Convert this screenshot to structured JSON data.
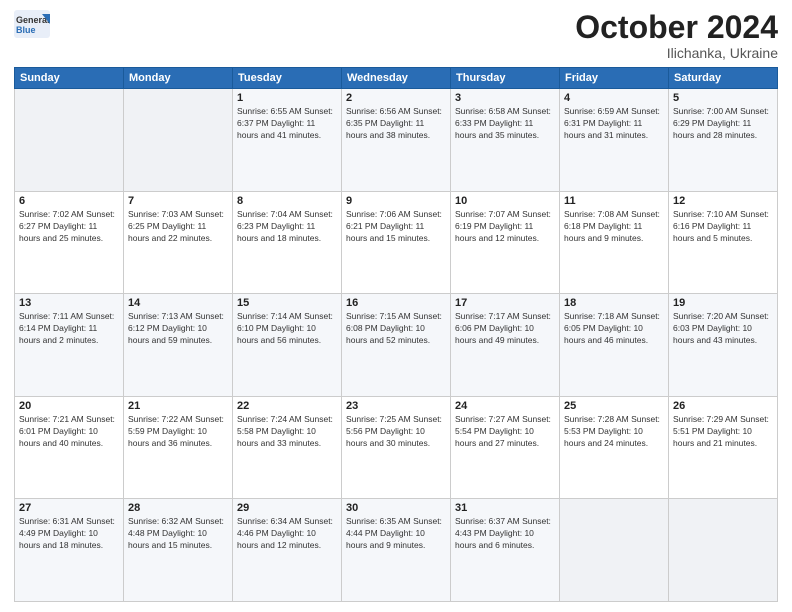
{
  "logo": {
    "general": "General",
    "blue": "Blue"
  },
  "header": {
    "month": "October 2024",
    "location": "Ilichanka, Ukraine"
  },
  "days_of_week": [
    "Sunday",
    "Monday",
    "Tuesday",
    "Wednesday",
    "Thursday",
    "Friday",
    "Saturday"
  ],
  "weeks": [
    [
      {
        "day": "",
        "info": ""
      },
      {
        "day": "",
        "info": ""
      },
      {
        "day": "1",
        "info": "Sunrise: 6:55 AM\nSunset: 6:37 PM\nDaylight: 11 hours and 41 minutes."
      },
      {
        "day": "2",
        "info": "Sunrise: 6:56 AM\nSunset: 6:35 PM\nDaylight: 11 hours and 38 minutes."
      },
      {
        "day": "3",
        "info": "Sunrise: 6:58 AM\nSunset: 6:33 PM\nDaylight: 11 hours and 35 minutes."
      },
      {
        "day": "4",
        "info": "Sunrise: 6:59 AM\nSunset: 6:31 PM\nDaylight: 11 hours and 31 minutes."
      },
      {
        "day": "5",
        "info": "Sunrise: 7:00 AM\nSunset: 6:29 PM\nDaylight: 11 hours and 28 minutes."
      }
    ],
    [
      {
        "day": "6",
        "info": "Sunrise: 7:02 AM\nSunset: 6:27 PM\nDaylight: 11 hours and 25 minutes."
      },
      {
        "day": "7",
        "info": "Sunrise: 7:03 AM\nSunset: 6:25 PM\nDaylight: 11 hours and 22 minutes."
      },
      {
        "day": "8",
        "info": "Sunrise: 7:04 AM\nSunset: 6:23 PM\nDaylight: 11 hours and 18 minutes."
      },
      {
        "day": "9",
        "info": "Sunrise: 7:06 AM\nSunset: 6:21 PM\nDaylight: 11 hours and 15 minutes."
      },
      {
        "day": "10",
        "info": "Sunrise: 7:07 AM\nSunset: 6:19 PM\nDaylight: 11 hours and 12 minutes."
      },
      {
        "day": "11",
        "info": "Sunrise: 7:08 AM\nSunset: 6:18 PM\nDaylight: 11 hours and 9 minutes."
      },
      {
        "day": "12",
        "info": "Sunrise: 7:10 AM\nSunset: 6:16 PM\nDaylight: 11 hours and 5 minutes."
      }
    ],
    [
      {
        "day": "13",
        "info": "Sunrise: 7:11 AM\nSunset: 6:14 PM\nDaylight: 11 hours and 2 minutes."
      },
      {
        "day": "14",
        "info": "Sunrise: 7:13 AM\nSunset: 6:12 PM\nDaylight: 10 hours and 59 minutes."
      },
      {
        "day": "15",
        "info": "Sunrise: 7:14 AM\nSunset: 6:10 PM\nDaylight: 10 hours and 56 minutes."
      },
      {
        "day": "16",
        "info": "Sunrise: 7:15 AM\nSunset: 6:08 PM\nDaylight: 10 hours and 52 minutes."
      },
      {
        "day": "17",
        "info": "Sunrise: 7:17 AM\nSunset: 6:06 PM\nDaylight: 10 hours and 49 minutes."
      },
      {
        "day": "18",
        "info": "Sunrise: 7:18 AM\nSunset: 6:05 PM\nDaylight: 10 hours and 46 minutes."
      },
      {
        "day": "19",
        "info": "Sunrise: 7:20 AM\nSunset: 6:03 PM\nDaylight: 10 hours and 43 minutes."
      }
    ],
    [
      {
        "day": "20",
        "info": "Sunrise: 7:21 AM\nSunset: 6:01 PM\nDaylight: 10 hours and 40 minutes."
      },
      {
        "day": "21",
        "info": "Sunrise: 7:22 AM\nSunset: 5:59 PM\nDaylight: 10 hours and 36 minutes."
      },
      {
        "day": "22",
        "info": "Sunrise: 7:24 AM\nSunset: 5:58 PM\nDaylight: 10 hours and 33 minutes."
      },
      {
        "day": "23",
        "info": "Sunrise: 7:25 AM\nSunset: 5:56 PM\nDaylight: 10 hours and 30 minutes."
      },
      {
        "day": "24",
        "info": "Sunrise: 7:27 AM\nSunset: 5:54 PM\nDaylight: 10 hours and 27 minutes."
      },
      {
        "day": "25",
        "info": "Sunrise: 7:28 AM\nSunset: 5:53 PM\nDaylight: 10 hours and 24 minutes."
      },
      {
        "day": "26",
        "info": "Sunrise: 7:29 AM\nSunset: 5:51 PM\nDaylight: 10 hours and 21 minutes."
      }
    ],
    [
      {
        "day": "27",
        "info": "Sunrise: 6:31 AM\nSunset: 4:49 PM\nDaylight: 10 hours and 18 minutes."
      },
      {
        "day": "28",
        "info": "Sunrise: 6:32 AM\nSunset: 4:48 PM\nDaylight: 10 hours and 15 minutes."
      },
      {
        "day": "29",
        "info": "Sunrise: 6:34 AM\nSunset: 4:46 PM\nDaylight: 10 hours and 12 minutes."
      },
      {
        "day": "30",
        "info": "Sunrise: 6:35 AM\nSunset: 4:44 PM\nDaylight: 10 hours and 9 minutes."
      },
      {
        "day": "31",
        "info": "Sunrise: 6:37 AM\nSunset: 4:43 PM\nDaylight: 10 hours and 6 minutes."
      },
      {
        "day": "",
        "info": ""
      },
      {
        "day": "",
        "info": ""
      }
    ]
  ]
}
